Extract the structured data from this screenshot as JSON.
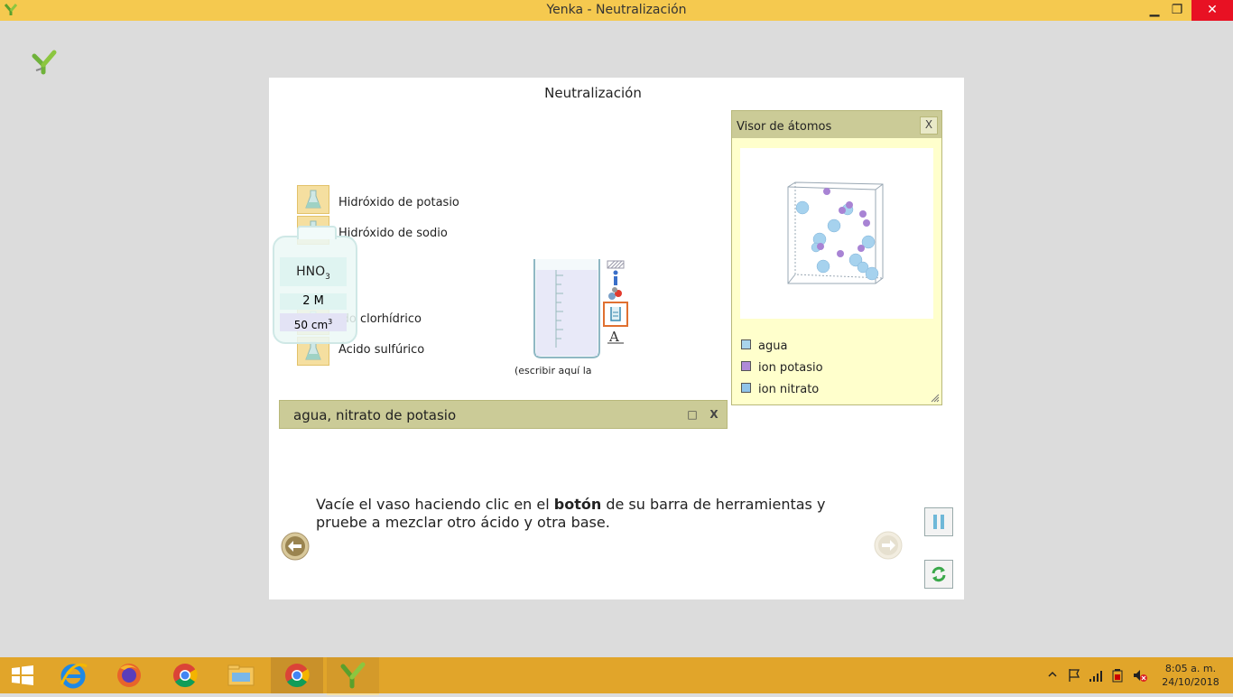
{
  "window": {
    "title": "Yenka - Neutralización",
    "minimize": "▁",
    "restore": "❐",
    "close": "✕"
  },
  "page": {
    "title": "Neutralización"
  },
  "chemicals": [
    {
      "label": "Hidróxido de potasio"
    },
    {
      "label": "Hidróxido de sodio"
    },
    {
      "label": "ido clorhídrico"
    },
    {
      "label": "Ácido sulfúrico"
    }
  ],
  "bottle": {
    "formula": "HNO",
    "formula_sub": "3",
    "concentration": "2 M",
    "volume": "50 cm",
    "volume_sup": "3"
  },
  "beaker": {
    "label": "(escribir aquí la"
  },
  "result": {
    "text": "agua,  nitrato de potasio",
    "maximize": "□",
    "close": "X"
  },
  "atom_viewer": {
    "title": "Visor de átomos",
    "close": "X",
    "legend": [
      {
        "label": "agua",
        "color": "#a9d4ec"
      },
      {
        "label": "ion potasio",
        "color": "#b08ad8"
      },
      {
        "label": "ion nitrato",
        "color": "#8fc3ea"
      }
    ]
  },
  "instruction": {
    "before": "Vacíe el vaso haciendo clic en el ",
    "bold": "botón",
    "after": " de su barra de herramientas y pruebe a mezclar otro ácido y otra base."
  },
  "taskbar": {
    "time": "8:05 a. m.",
    "date": "24/10/2018"
  },
  "colors": {
    "titlebar": "#f5c94f",
    "taskbar": "#e1a52a",
    "panel_header": "#cbcb97",
    "atom_panel_bg": "#ffffcc"
  }
}
